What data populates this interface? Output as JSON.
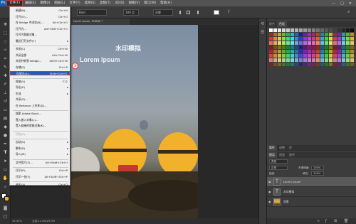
{
  "menubar": {
    "logo": "Ps",
    "items": [
      "文件(F)",
      "编辑(E)",
      "图像(I)",
      "图层(L)",
      "文字(Y)",
      "选择(S)",
      "滤镜(T)",
      "3D(D)",
      "视图(V)",
      "窗口(W)",
      "帮助(H)"
    ],
    "window_buttons": [
      "—",
      "□",
      "✕"
    ]
  },
  "options": {
    "font_style": "Bold",
    "font_size": "100 点",
    "anti_alias": "浑厚"
  },
  "document": {
    "tab_title": "Lorem Ipsum, RGB/8) *",
    "status": "33.33%",
    "status_doc": "文档:11.0M/29.9M"
  },
  "canvas": {
    "watermark_text": "水印模拟",
    "lorem_text": "Lorem Ipsum",
    "colors": {
      "sky_top": "#7d8ea2",
      "balloon_orange": "#f2b12a",
      "balloon_stripe": "#3a2a1a",
      "van_red": "#c23a2a"
    }
  },
  "file_menu": {
    "items": [
      {
        "label": "新建(N)...",
        "shortcut": "Ctrl+N"
      },
      {
        "label": "打开(O)...",
        "shortcut": "Ctrl+O"
      },
      {
        "label": "在 Bridge 中浏览(B)...",
        "shortcut": "Alt+Ctrl+O"
      },
      {
        "label": "打开为...",
        "shortcut": "Alt+Shift+Ctrl+O"
      },
      {
        "label": "打开为智能对象..."
      },
      {
        "label": "最近打开文件(T)",
        "submenu": true
      },
      {
        "label": "关闭(C)",
        "shortcut": "Ctrl+W"
      },
      {
        "label": "关闭全部",
        "shortcut": "Alt+Ctrl+W"
      },
      {
        "label": "关闭并转到 Bridge...",
        "shortcut": "Shift+Ctrl+W"
      },
      {
        "label": "存储(S)",
        "shortcut": "Ctrl+S"
      },
      {
        "label": "存储为(A)...",
        "shortcut": "Shift+Ctrl+S",
        "highlight": true
      },
      {
        "label": "恢复(V)",
        "shortcut": "F12"
      },
      {
        "label": "导出(E)",
        "submenu": true
      },
      {
        "label": "生成",
        "submenu": true
      },
      {
        "label": "共享(S)..."
      },
      {
        "label": "在 Behance 上共享(D)..."
      },
      {
        "label": "搜索 Adobe Stock..."
      },
      {
        "label": "置入嵌入对象(L)..."
      },
      {
        "label": "置入链接的智能对象(K)..."
      },
      {
        "label": "打包(G)...",
        "disabled": true
      },
      {
        "label": "自动(U)",
        "submenu": true
      },
      {
        "label": "脚本(R)",
        "submenu": true
      },
      {
        "label": "导入(M)",
        "submenu": true
      },
      {
        "label": "文件简介(F)...",
        "shortcut": "Alt+Shift+Ctrl+I"
      },
      {
        "label": "打印(P)...",
        "shortcut": "Ctrl+P"
      },
      {
        "label": "打印一份(Y)",
        "shortcut": "Alt+Shift+Ctrl+P"
      },
      {
        "label": "退出(X)",
        "shortcut": "Ctrl+Q"
      }
    ],
    "step_badge": "②"
  },
  "panels": {
    "top_tabs": [
      "颜色",
      "色板"
    ],
    "mid_tabs": [
      "属性",
      "调整",
      "库"
    ],
    "layers_tabs": [
      "图层",
      "通道",
      "路径"
    ],
    "blend_mode": "正常",
    "opacity_label": "不透明度:",
    "opacity_value": "100%",
    "lock_label": "锁定:",
    "fill_label": "填充:",
    "fill_value": "100%",
    "filter_label": "类型",
    "layers": [
      {
        "name": "Lorem Ipsum",
        "kind": "text",
        "selected": true
      },
      {
        "name": "水印模拟",
        "kind": "text"
      },
      {
        "name": "背景",
        "kind": "image"
      }
    ]
  }
}
